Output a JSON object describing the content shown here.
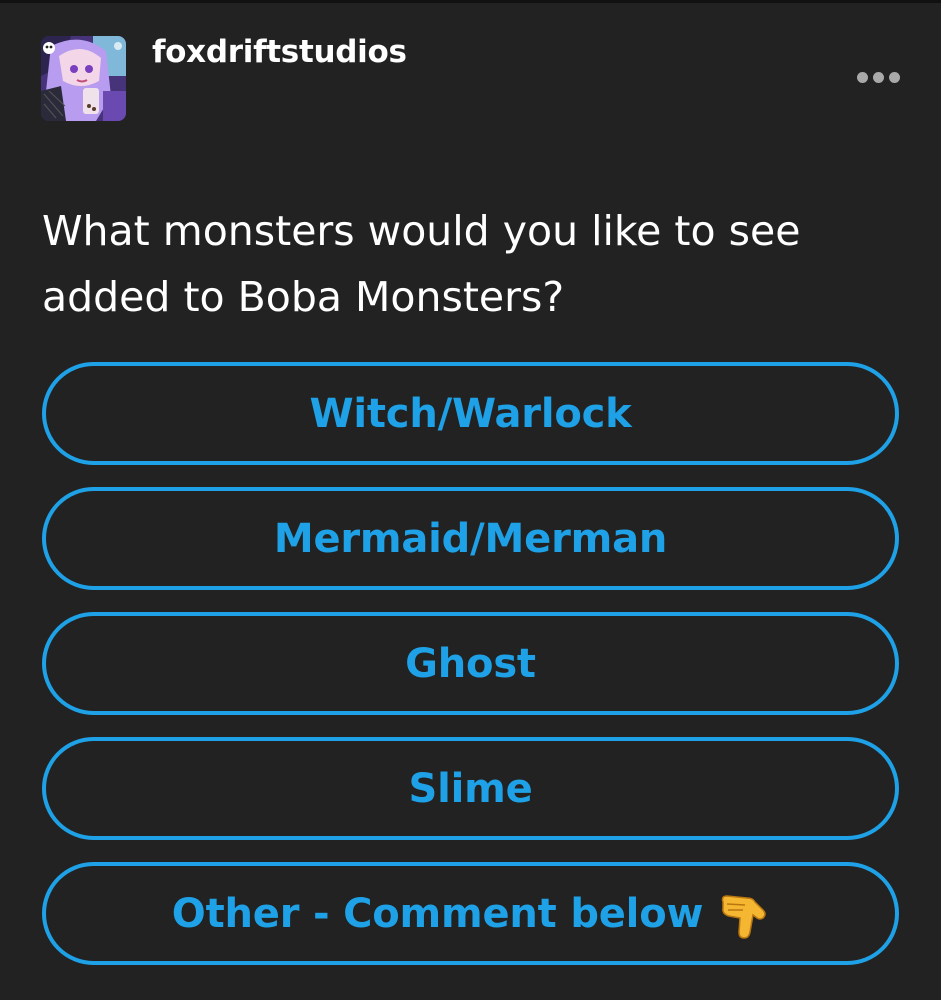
{
  "post": {
    "username": "foxdriftstudios",
    "more_icon": "more-horizontal-icon",
    "question": "What monsters would you like to see added to Boba Monsters?"
  },
  "poll": {
    "options": [
      {
        "label": "Witch/Warlock"
      },
      {
        "label": "Mermaid/Merman"
      },
      {
        "label": "Ghost"
      },
      {
        "label": "Slime"
      },
      {
        "label": "Other - Comment below",
        "emoji": "backhand-index-pointing-down-icon"
      }
    ]
  },
  "colors": {
    "background": "#222222",
    "accent": "#1ea1e6",
    "text": "#ffffff",
    "muted": "#a9a9a9"
  }
}
